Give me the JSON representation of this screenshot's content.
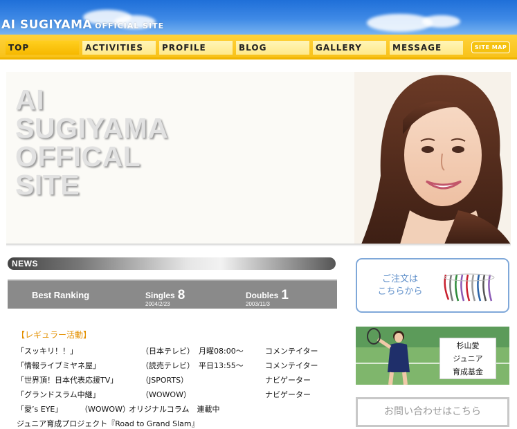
{
  "header": {
    "title": "AI SUGIYAMA",
    "subtitle": "OFFICIAL SITE"
  },
  "nav": {
    "items": [
      {
        "label": "TOP"
      },
      {
        "label": "ACTIVITIES"
      },
      {
        "label": "PROFILE"
      },
      {
        "label": "BLOG"
      },
      {
        "label": "GALLERY"
      },
      {
        "label": "MESSAGE"
      }
    ],
    "sitemap_label": "SITE MAP"
  },
  "hero": {
    "lines": [
      "AI",
      "SUGIYAMA",
      "OFFICAL",
      "SITE"
    ]
  },
  "news": {
    "heading": "NEWS"
  },
  "ranking": {
    "label": "Best Ranking",
    "singles_label": "Singles",
    "singles_value": "8",
    "singles_date": "2004/2/23",
    "doubles_label": "Doubles",
    "doubles_value": "1",
    "doubles_date": "2003/11/3"
  },
  "activities": {
    "heading": "【レギュラー活動】",
    "rows": [
      {
        "program": "「スッキリ！！」",
        "channel": "（日本テレビ）",
        "time": "月曜08:00～",
        "role": "コメンテイター"
      },
      {
        "program": "「情報ライブミヤネ屋」",
        "channel": "（読売テレビ）",
        "time": "平日13:55～",
        "role": "コメンテイター"
      },
      {
        "program": "「世界頂！日本代表応援TV」",
        "channel": "（JSPORTS）",
        "time": "",
        "role": "ナビゲーター"
      },
      {
        "program": "「グランドスラム中継」",
        "channel": "（WOWOW）",
        "time": "",
        "role": "ナビゲーター"
      }
    ],
    "eye_line": {
      "program": "「愛’s EYE」",
      "channel": "（WOWOW）",
      "note": "オリジナルコラム　連載中"
    },
    "project_line": "ジュニア育成プロジェクト『Road to Grand Slam』"
  },
  "sidebar": {
    "order_text": [
      "ご注文は",
      "こちらから"
    ],
    "junior_label": [
      "杉山愛",
      "ジュニア",
      "育成基金"
    ],
    "contact_label": "お問い合わせはこちら"
  },
  "colors": {
    "sky": "#2f7fe0",
    "nav_yellow": "#f8c21a",
    "activity_heading": "#e39000",
    "order_blue": "#5d8ec9",
    "ranking_gray": "#8a8a8a"
  }
}
